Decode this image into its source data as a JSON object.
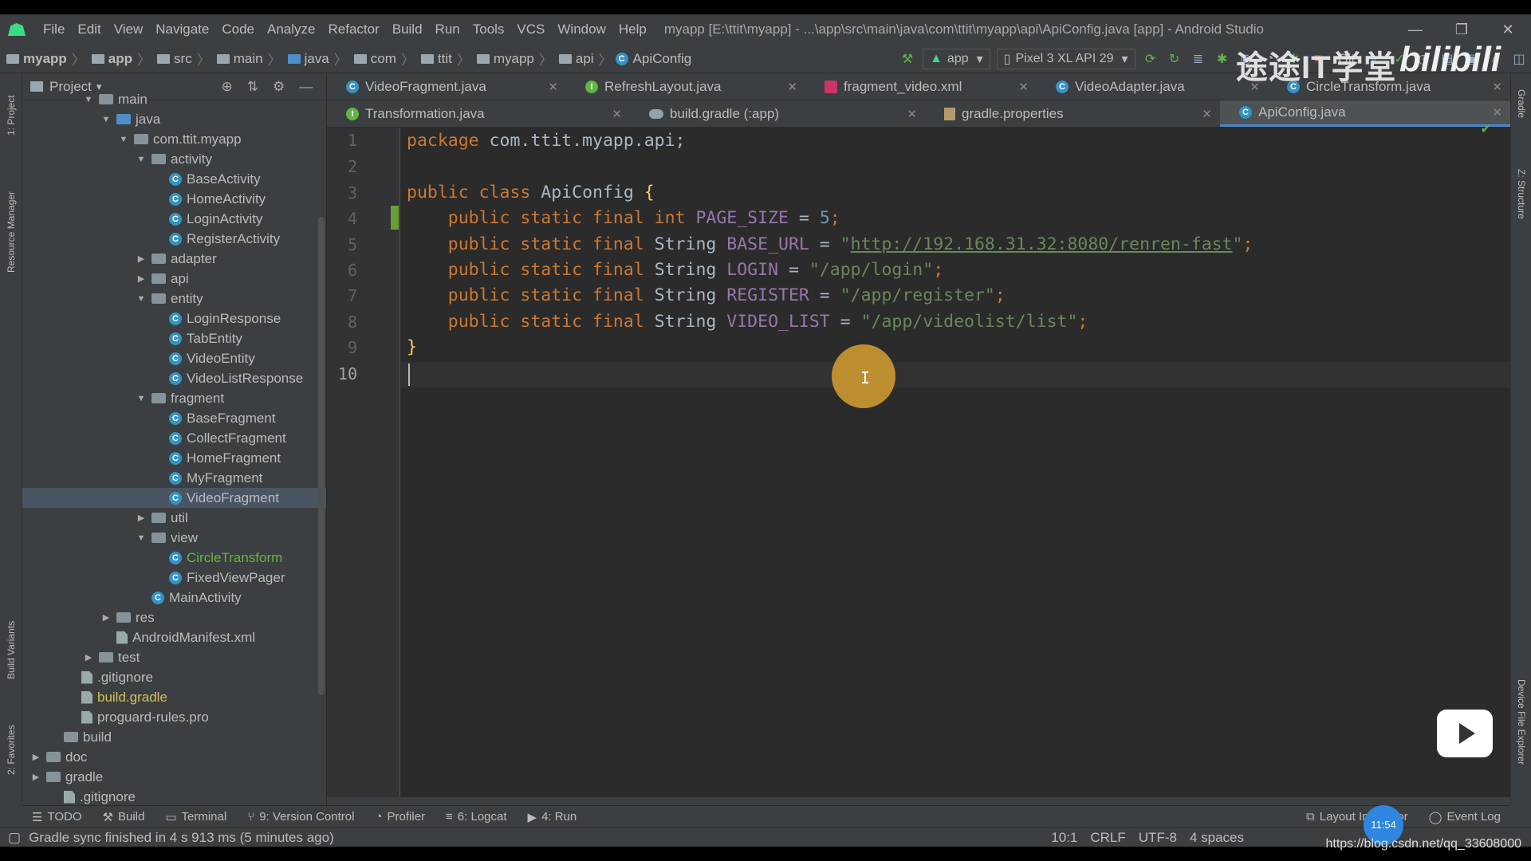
{
  "window": {
    "title": "myapp [E:\\ttit\\myapp] - ...\\app\\src\\main\\java\\com\\ttit\\myapp\\api\\ApiConfig.java [app] - Android Studio",
    "controls": [
      "—",
      "❐",
      "✕"
    ]
  },
  "menu": [
    "File",
    "Edit",
    "View",
    "Navigate",
    "Code",
    "Analyze",
    "Refactor",
    "Build",
    "Run",
    "Tools",
    "VCS",
    "Window",
    "Help"
  ],
  "breadcrumbs": [
    "myapp",
    "app",
    "src",
    "main",
    "java",
    "com",
    "ttit",
    "myapp",
    "api",
    "ApiConfig"
  ],
  "toolbar": {
    "run_config": "app",
    "device": "Pixel 3 XL API 29",
    "git_label": "Git:"
  },
  "project_panel": {
    "title": "Project",
    "tree": [
      {
        "label": "main",
        "depth": 0,
        "arrow": "▼",
        "icon": "folder"
      },
      {
        "label": "java",
        "depth": 1,
        "arrow": "▼",
        "icon": "src-folder"
      },
      {
        "label": "com.ttit.myapp",
        "depth": 2,
        "arrow": "▼",
        "icon": "folder"
      },
      {
        "label": "activity",
        "depth": 3,
        "arrow": "▼",
        "icon": "folder"
      },
      {
        "label": "BaseActivity",
        "depth": 4,
        "arrow": "",
        "icon": "class"
      },
      {
        "label": "HomeActivity",
        "depth": 4,
        "arrow": "",
        "icon": "class"
      },
      {
        "label": "LoginActivity",
        "depth": 4,
        "arrow": "",
        "icon": "class"
      },
      {
        "label": "RegisterActivity",
        "depth": 4,
        "arrow": "",
        "icon": "class"
      },
      {
        "label": "adapter",
        "depth": 3,
        "arrow": "▶",
        "icon": "folder"
      },
      {
        "label": "api",
        "depth": 3,
        "arrow": "▶",
        "icon": "folder"
      },
      {
        "label": "entity",
        "depth": 3,
        "arrow": "▼",
        "icon": "folder"
      },
      {
        "label": "LoginResponse",
        "depth": 4,
        "arrow": "",
        "icon": "class"
      },
      {
        "label": "TabEntity",
        "depth": 4,
        "arrow": "",
        "icon": "class"
      },
      {
        "label": "VideoEntity",
        "depth": 4,
        "arrow": "",
        "icon": "class"
      },
      {
        "label": "VideoListResponse",
        "depth": 4,
        "arrow": "",
        "icon": "class"
      },
      {
        "label": "fragment",
        "depth": 3,
        "arrow": "▼",
        "icon": "folder"
      },
      {
        "label": "BaseFragment",
        "depth": 4,
        "arrow": "",
        "icon": "class"
      },
      {
        "label": "CollectFragment",
        "depth": 4,
        "arrow": "",
        "icon": "class"
      },
      {
        "label": "HomeFragment",
        "depth": 4,
        "arrow": "",
        "icon": "class"
      },
      {
        "label": "MyFragment",
        "depth": 4,
        "arrow": "",
        "icon": "class"
      },
      {
        "label": "VideoFragment",
        "depth": 4,
        "arrow": "",
        "icon": "class",
        "selected": true
      },
      {
        "label": "util",
        "depth": 3,
        "arrow": "▶",
        "icon": "folder"
      },
      {
        "label": "view",
        "depth": 3,
        "arrow": "▼",
        "icon": "folder"
      },
      {
        "label": "CircleTransform",
        "depth": 4,
        "arrow": "",
        "icon": "class",
        "green": true
      },
      {
        "label": "FixedViewPager",
        "depth": 4,
        "arrow": "",
        "icon": "class"
      },
      {
        "label": "MainActivity",
        "depth": 3,
        "arrow": "",
        "icon": "class"
      },
      {
        "label": "res",
        "depth": 1,
        "arrow": "▶",
        "icon": "folder"
      },
      {
        "label": "AndroidManifest.xml",
        "depth": 1,
        "arrow": "",
        "icon": "file"
      },
      {
        "label": "test",
        "depth": 0,
        "arrow": "▶",
        "icon": "folder"
      },
      {
        "label": ".gitignore",
        "depth": -1,
        "arrow": "",
        "icon": "file"
      },
      {
        "label": "build.gradle",
        "depth": -1,
        "arrow": "",
        "icon": "file",
        "yellow": true
      },
      {
        "label": "proguard-rules.pro",
        "depth": -1,
        "arrow": "",
        "icon": "file"
      },
      {
        "label": "build",
        "depth": -2,
        "arrow": "",
        "icon": "folder"
      },
      {
        "label": "doc",
        "depth": -3,
        "arrow": "▶",
        "icon": "folder"
      },
      {
        "label": "gradle",
        "depth": -3,
        "arrow": "▶",
        "icon": "folder"
      },
      {
        "label": ".gitignore",
        "depth": -2,
        "arrow": "",
        "icon": "file"
      }
    ]
  },
  "tabs_row1": [
    {
      "label": "VideoFragment.java",
      "icon": "class"
    },
    {
      "label": "RefreshLayout.java",
      "icon": "interface"
    },
    {
      "label": "fragment_video.xml",
      "icon": "xml"
    },
    {
      "label": "VideoAdapter.java",
      "icon": "class"
    },
    {
      "label": "CircleTransform.java",
      "icon": "class"
    }
  ],
  "tabs_row2": [
    {
      "label": "Transformation.java",
      "icon": "interface"
    },
    {
      "label": "build.gradle (:app)",
      "icon": "gradle"
    },
    {
      "label": "gradle.properties",
      "icon": "props"
    },
    {
      "label": "ApiConfig.java",
      "icon": "class",
      "active": true
    }
  ],
  "editor": {
    "line_numbers": [
      "1",
      "2",
      "3",
      "4",
      "5",
      "6",
      "7",
      "8",
      "9",
      "10"
    ],
    "current_line": 10,
    "code": {
      "l1_kw": "package",
      "l1_rest": " com.ttit.myapp.api;",
      "l3_kw": "public class",
      "l3_cls": " ApiConfig ",
      "l3_brace": "{",
      "mod": "public static final",
      "l4_type": " int",
      "l4_field": " PAGE_SIZE",
      "l4_eq": " = ",
      "l4_val": "5",
      "l4_end": ";",
      "l5_type": " String",
      "l5_field": " BASE_URL",
      "l5_eq": " = ",
      "l5_q1": "\"",
      "l5_url": "http://192.168.31.32:8080/renren-fast",
      "l5_q2": "\"",
      "l5_end": ";",
      "l6_type": " String",
      "l6_field": " LOGIN",
      "l6_eq": " = ",
      "l6_val": "\"/app/login\"",
      "l6_end": ";",
      "l7_type": " String",
      "l7_field": " REGISTER",
      "l7_eq": " = ",
      "l7_val": "\"/app/register\"",
      "l7_end": ";",
      "l8_type": " String",
      "l8_field": " VIDEO_LIST",
      "l8_eq": " = ",
      "l8_val": "\"/app/videolist/list\"",
      "l8_end": ";",
      "l9": "}"
    }
  },
  "tool_windows": {
    "left": [
      "1: Project",
      "Resource Manager",
      "Build Variants",
      "2: Favorites"
    ],
    "right": [
      "Gradle",
      "Z: Structure",
      "Device File Explorer"
    ],
    "bottom": [
      "TODO",
      "Build",
      "Terminal",
      "9: Version Control",
      "Profiler",
      "6: Logcat",
      "4: Run"
    ],
    "bottom_right": [
      "Layout Inspector",
      "Event Log"
    ]
  },
  "status_bar": {
    "message": "Gradle sync finished in 4 s 913 ms (5 minutes ago)",
    "position": "10:1",
    "line_sep": "CRLF",
    "encoding": "UTF-8",
    "indent": "4 spaces"
  },
  "overlays": {
    "watermark": "途途IT学堂",
    "bili": "bilibili",
    "time": "11:54",
    "csdn_url": "https://blog.csdn.net/qq_33608000"
  }
}
